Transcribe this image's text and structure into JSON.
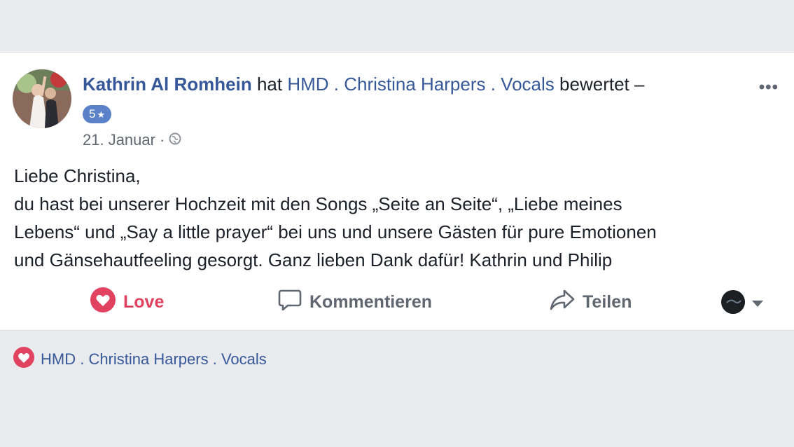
{
  "post": {
    "author": "Kathrin Al Romhein",
    "action_pre": "hat",
    "page": "HMD . Christina Harpers . Vocals",
    "action_post": "bewertet –",
    "rating": "5",
    "rating_icon": "star-icon",
    "date": "21. Januar",
    "separator": "·",
    "privacy_icon": "globe-icon",
    "more_label": "•••",
    "text": {
      "line1": "Liebe Christina,",
      "line2": "du hast bei unserer Hochzeit mit den Songs „Seite an Seite“, „Liebe meines",
      "line3": "Lebens“ und „Say a little prayer“ bei uns und unsere Gästen für pure Emotionen",
      "line4": "und Gänsehautfeeling gesorgt. Ganz lieben Dank dafür! Kathrin und Philip"
    }
  },
  "actions": {
    "love": "Love",
    "comment": "Kommentieren",
    "share": "Teilen"
  },
  "reactions": {
    "name": "HMD . Christina Harpers . Vocals"
  },
  "colors": {
    "link": "#365899",
    "love": "#e0425f",
    "background": "#e9ebee"
  }
}
